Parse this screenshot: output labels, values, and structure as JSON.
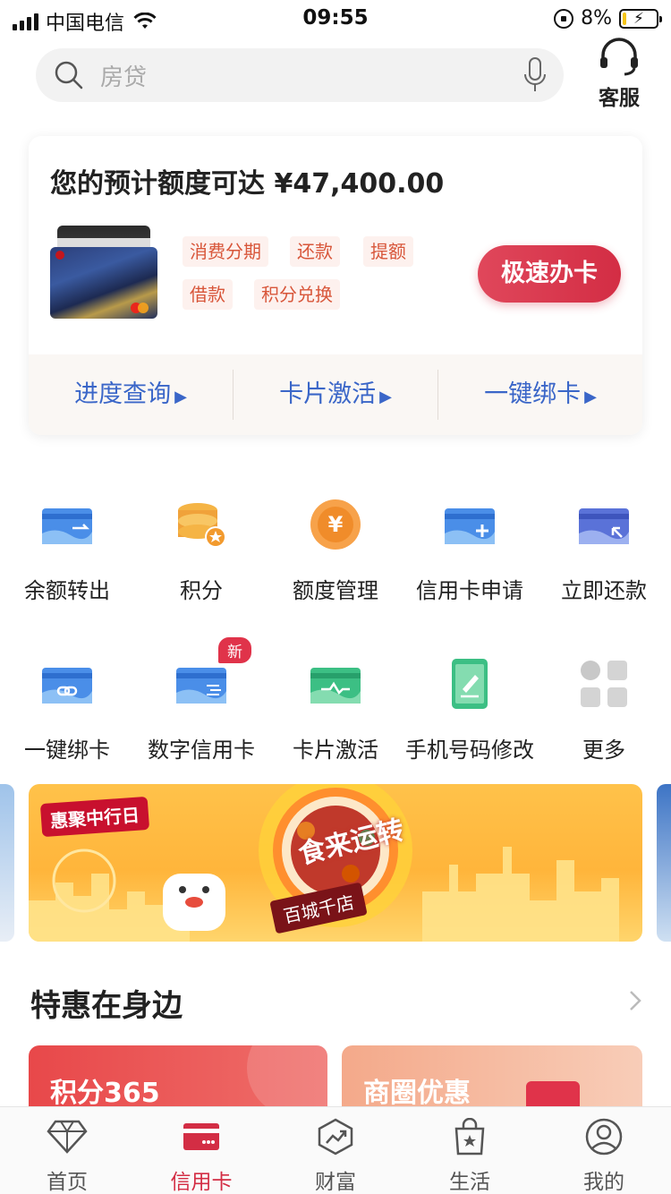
{
  "status_bar": {
    "carrier": "中国电信",
    "time": "09:55",
    "battery": "8%"
  },
  "search": {
    "placeholder": "房贷",
    "service_label": "客服"
  },
  "credit_panel": {
    "title": "您的预计额度可达 ¥47,400.00",
    "tags": [
      "消费分期",
      "还款",
      "提额",
      "借款",
      "积分兑换"
    ],
    "apply_button": "极速办卡",
    "quick_links": [
      "进度查询",
      "卡片激活",
      "一键绑卡"
    ],
    "arrow": "▶"
  },
  "grid": {
    "row1": [
      {
        "label": "余额转出",
        "icon": "card-transfer-icon"
      },
      {
        "label": "积分",
        "icon": "coins-star-icon"
      },
      {
        "label": "额度管理",
        "icon": "yen-coin-icon"
      },
      {
        "label": "信用卡申请",
        "icon": "card-add-icon"
      },
      {
        "label": "立即还款",
        "icon": "card-repay-icon"
      }
    ],
    "row2": [
      {
        "label": "一键绑卡",
        "icon": "card-link-icon"
      },
      {
        "label": "数字信用卡",
        "icon": "digital-card-icon",
        "badge": "新"
      },
      {
        "label": "卡片激活",
        "icon": "card-activate-icon"
      },
      {
        "label": "手机号码修改",
        "icon": "phone-edit-icon"
      },
      {
        "label": "更多",
        "icon": "more-grid-icon"
      }
    ]
  },
  "banner": {
    "logo": "惠聚中行日",
    "headline": "食来运转",
    "shop_label": "百城千店"
  },
  "section": {
    "title": "特惠在身边",
    "cards": [
      "积分365",
      "商圈优惠"
    ]
  },
  "tabbar": {
    "tabs": [
      {
        "label": "首页",
        "icon": "diamond-icon"
      },
      {
        "label": "信用卡",
        "icon": "credit-card-icon",
        "active": true
      },
      {
        "label": "财富",
        "icon": "wealth-chart-icon"
      },
      {
        "label": "生活",
        "icon": "shopping-bag-icon"
      },
      {
        "label": "我的",
        "icon": "user-icon"
      }
    ]
  },
  "colors": {
    "accent_red": "#d32d44",
    "link_blue": "#3a66c8",
    "tag_text": "#d8563a",
    "tag_bg": "#fdf1ee"
  }
}
